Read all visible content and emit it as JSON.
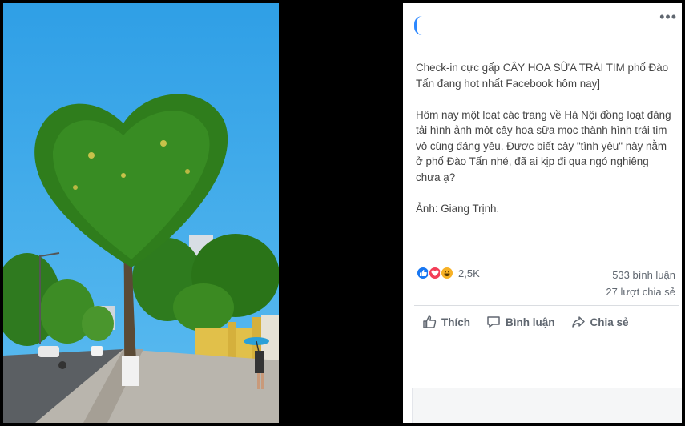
{
  "photo": {
    "alt": "",
    "watermark": ""
  },
  "post": {
    "more_label": "•••",
    "paragraphs": [
      "Check-in cực gấp CÂY HOA SỮA TRÁI TIM phố Đào Tấn đang hot nhất Facebook hôm nay]",
      "Hôm nay một loạt các trang về Hà Nội đồng loạt đăng tải hình ảnh một cây hoa sữa mọc thành hình trái tim vô cùng đáng yêu. Được biết cây \"tình yêu\" này nằm ở phố Đào Tấn nhé, đã ai kịp đi qua ngó nghiêng chưa ạ?",
      "Ảnh: Giang Trịnh."
    ],
    "reaction_count": "2,5K",
    "comments": "533 bình luận",
    "shares": "27 lượt chia sẻ",
    "actions": {
      "like": "Thích",
      "comment": "Bình luận",
      "share": "Chia sẻ"
    }
  },
  "colors": {
    "like_blue": "#1877f2",
    "love_red": "#f33e58",
    "haha_yellow": "#f7b125",
    "sky": "#36a7ea"
  }
}
